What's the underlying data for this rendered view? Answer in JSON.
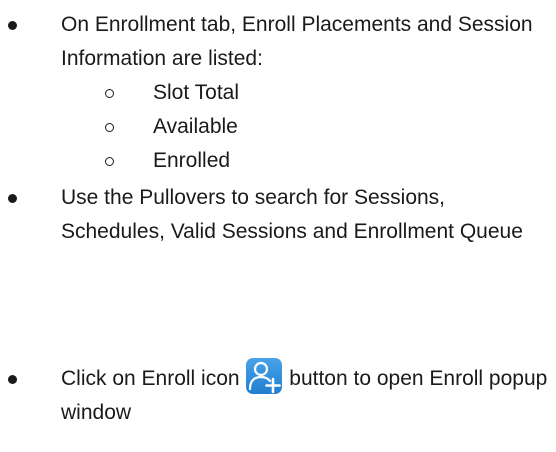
{
  "bullets": [
    {
      "text": "On Enrollment tab, Enroll Placements and Session Information are listed:",
      "sub_items": [
        "Slot Total",
        "Available",
        "Enrolled"
      ]
    },
    {
      "text": "Use the Pullovers to search for Sessions, Schedules, Valid Sessions and Enrollment Queue"
    },
    {
      "text_before_icon": "Click on Enroll icon",
      "icon": "enroll-user-add-icon",
      "text_after_icon": "button to open Enroll popup window"
    }
  ],
  "colors": {
    "text": "#1a1a1a",
    "icon_background": "#2b8fdf",
    "icon_foreground": "#ffffff"
  }
}
